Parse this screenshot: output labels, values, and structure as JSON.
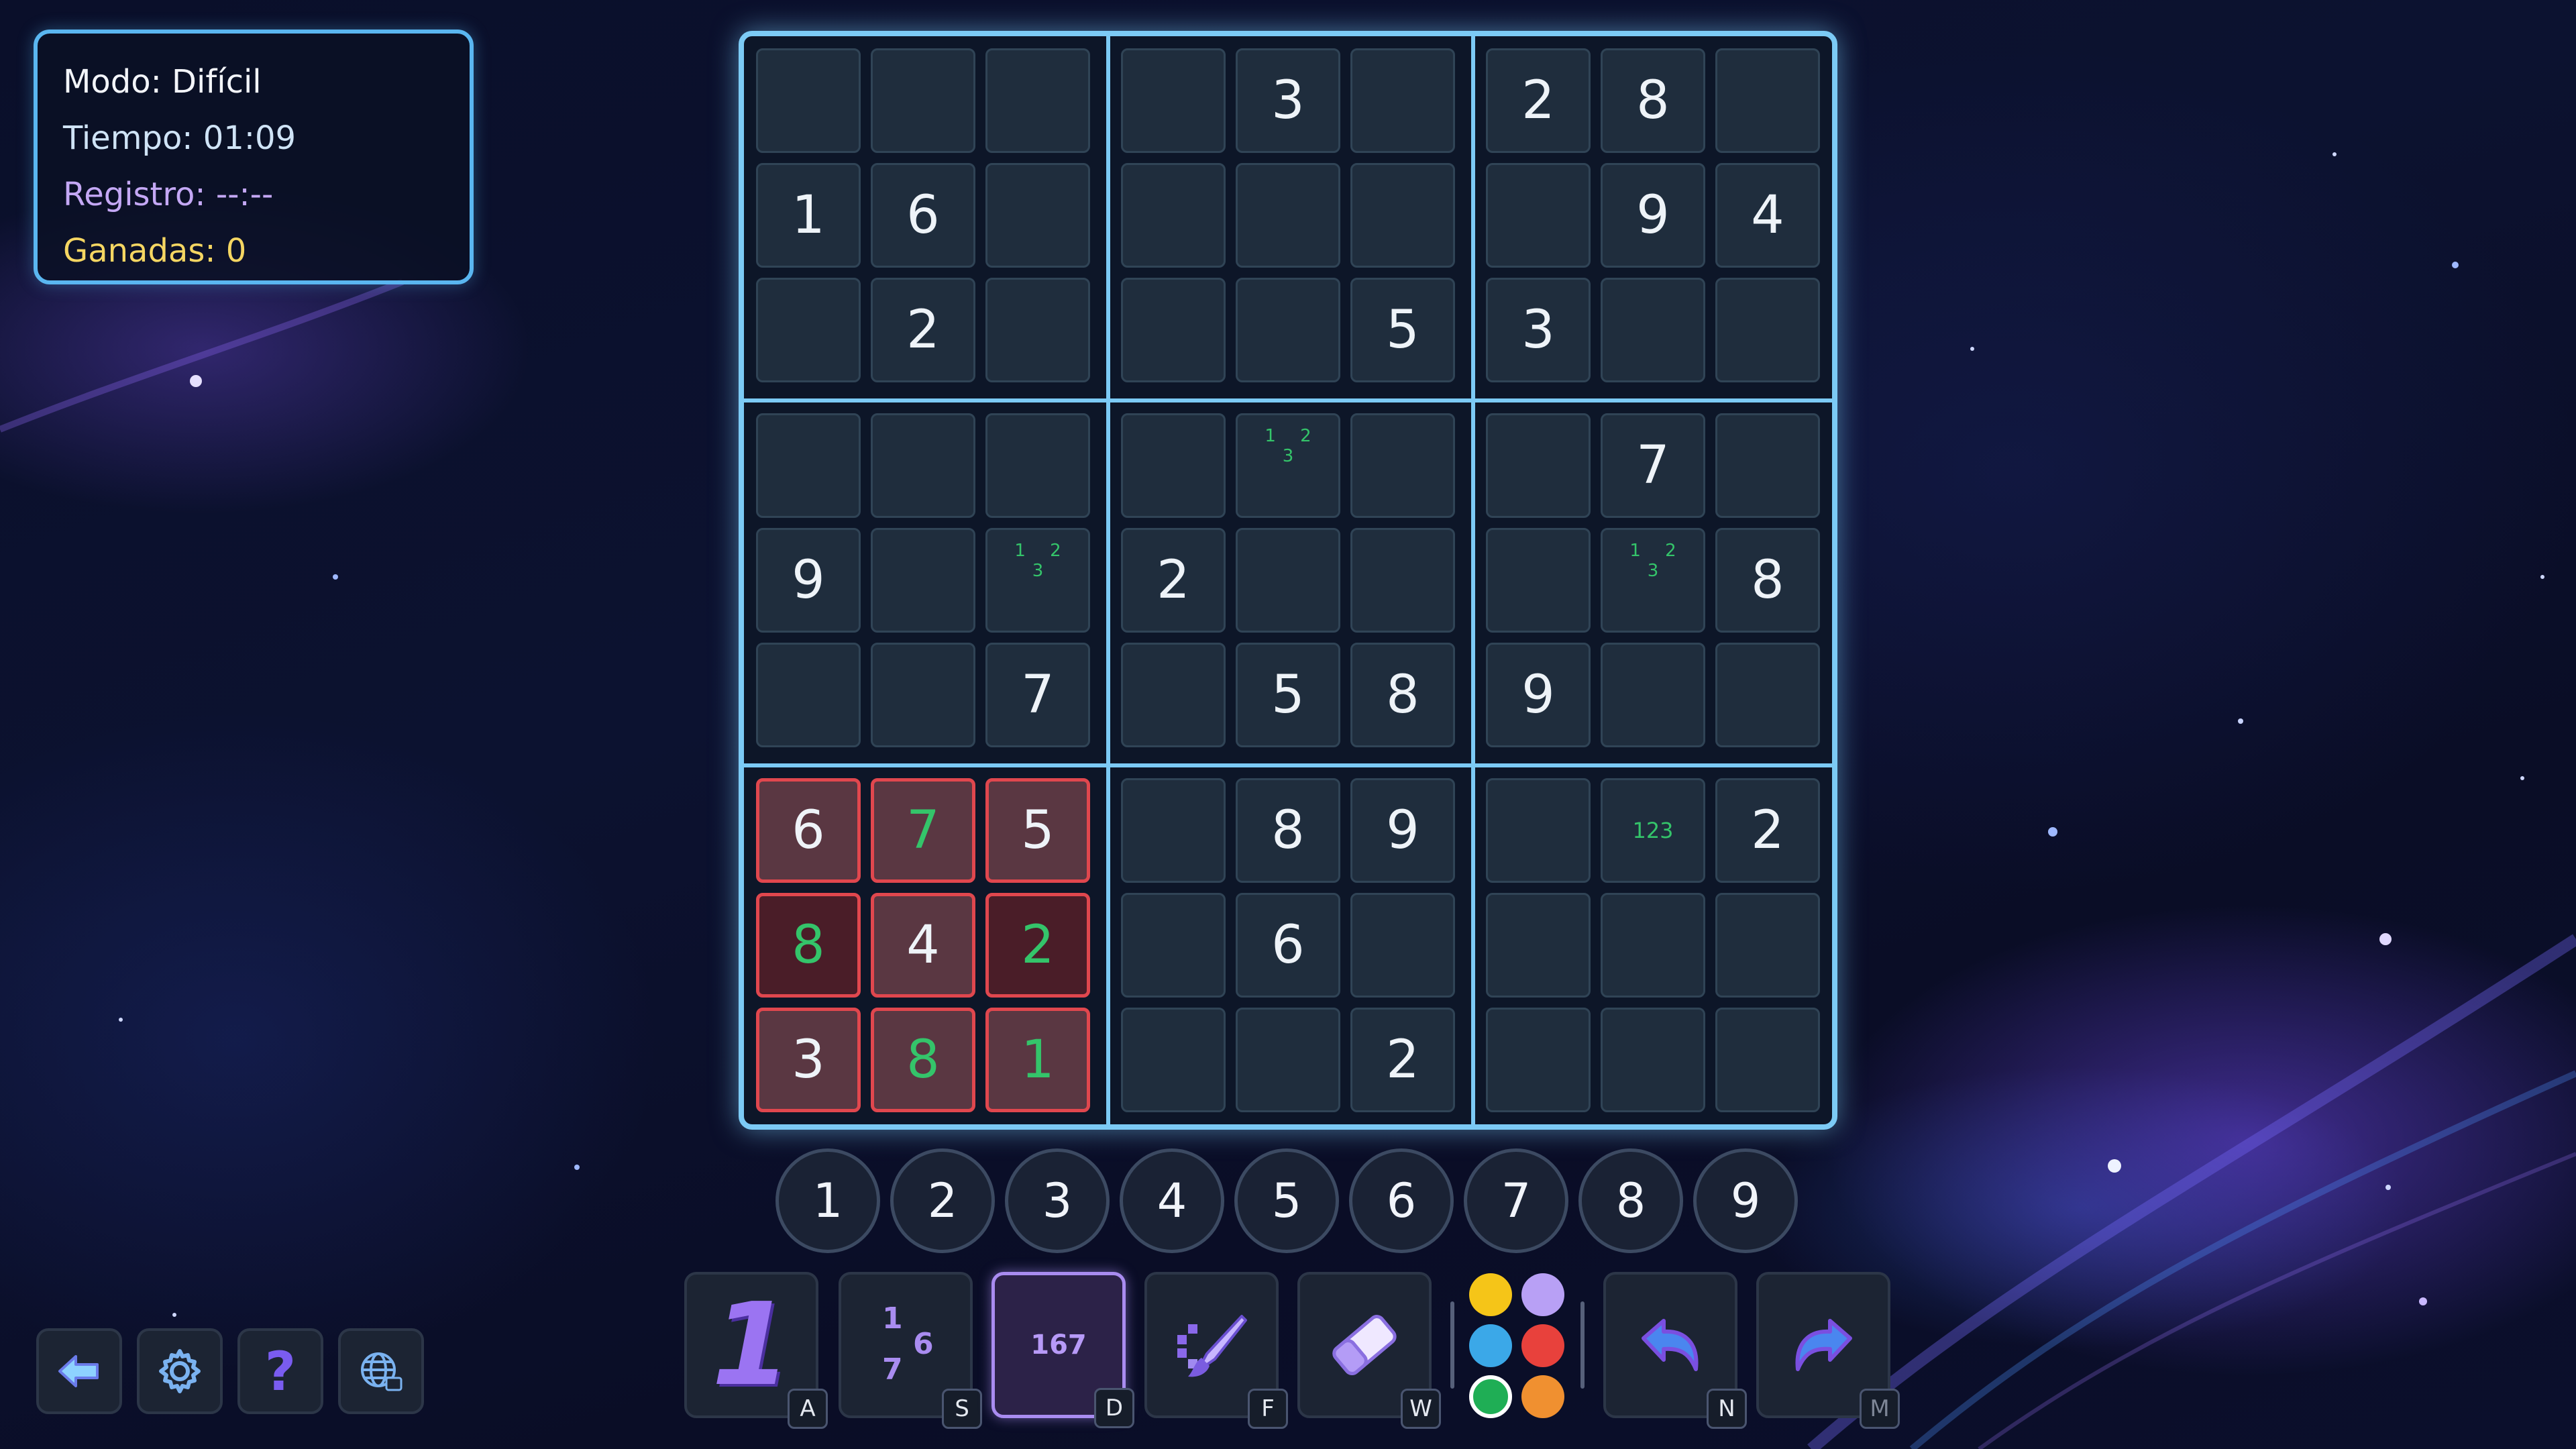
{
  "info": {
    "mode_label": "Modo: Difícil",
    "time_label": "Tiempo: 01:09",
    "record_label": "Registro: --:--",
    "wins_label": "Ganadas: 0"
  },
  "board": {
    "cells": [
      [
        "",
        "",
        "",
        "",
        "3",
        "",
        "2",
        "8",
        ""
      ],
      [
        "1",
        "6",
        "",
        "",
        "",
        "",
        "",
        "9",
        "4"
      ],
      [
        "",
        "2",
        "",
        "",
        "",
        "5",
        "3",
        "",
        ""
      ],
      [
        "",
        "",
        "",
        "",
        "1 2 3",
        "",
        "",
        "7",
        ""
      ],
      [
        "9",
        "",
        "1 2 3",
        "2",
        "",
        "",
        "",
        "1 2 3",
        "8"
      ],
      [
        "",
        "",
        "7",
        "",
        "5",
        "8",
        "9",
        "",
        ""
      ],
      [
        "6",
        "7",
        "5",
        "",
        "8",
        "9",
        "",
        "123",
        "2"
      ],
      [
        "8",
        "4",
        "2",
        "",
        "6",
        "",
        "",
        "",
        ""
      ],
      [
        "3",
        "8",
        "1",
        "",
        "",
        "2",
        "",
        "",
        ""
      ]
    ],
    "notes_cells": [
      "3-4",
      "4-2",
      "4-7",
      "6-7"
    ],
    "green_cells": [
      "6-1",
      "7-0",
      "7-2",
      "8-1",
      "8-2"
    ],
    "conflict_cells": [
      "6-0",
      "6-1",
      "6-2",
      "7-0",
      "7-1",
      "7-2",
      "8-0",
      "8-1",
      "8-2"
    ]
  },
  "numpad": [
    "1",
    "2",
    "3",
    "4",
    "5",
    "6",
    "7",
    "8",
    "9"
  ],
  "tools": {
    "digit_mode": {
      "icon": "number-one-icon",
      "glyph": "1",
      "key": "A"
    },
    "corner_notes": {
      "icon": "corner-notes-icon",
      "glyph_1": "1",
      "glyph_6": "6",
      "glyph_7": "7",
      "key": "S"
    },
    "center_notes": {
      "icon": "center-notes-icon",
      "glyph": "167",
      "key": "D"
    },
    "paint": {
      "icon": "brush-icon",
      "key": "F"
    },
    "eraser": {
      "icon": "eraser-icon",
      "key": "W"
    },
    "undo": {
      "icon": "undo-arrow-icon",
      "key": "N"
    },
    "redo": {
      "icon": "redo-arrow-icon",
      "key": "M"
    }
  },
  "colors": [
    "#f5c518",
    "#b8a0f5",
    "#3ba8e8",
    "#e8413c",
    "#1fae55",
    "#f09030"
  ],
  "selected_color": "#1fae55",
  "nav": [
    "back-arrow-icon",
    "gear-icon",
    "help-question-icon",
    "language-globe-icon"
  ],
  "theme": {
    "accent": "#7ccaf5",
    "text_time": "#cfe3f6",
    "text_record": "#c4a8f5",
    "text_wins": "#f5d662",
    "note_green": "#34c46a",
    "conflict_red": "#e0474e"
  }
}
